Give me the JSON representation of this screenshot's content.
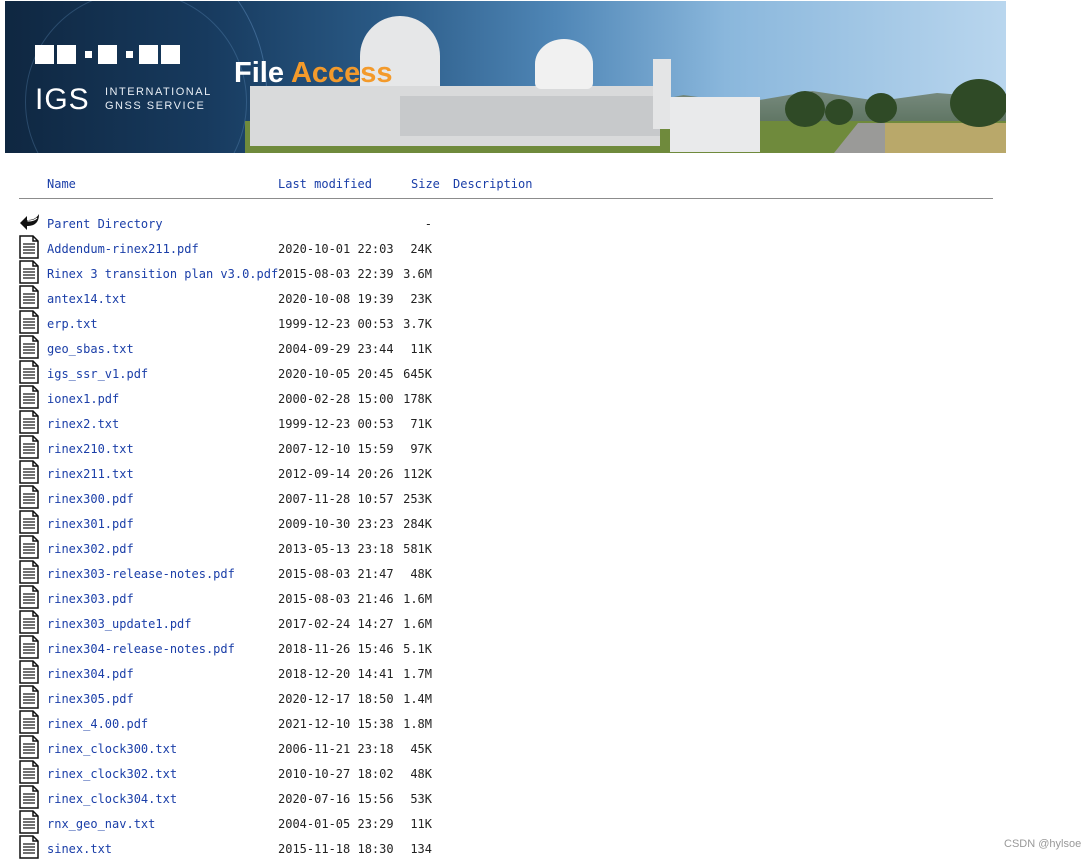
{
  "banner": {
    "org_short": "IGS",
    "org_line1": "INTERNATIONAL",
    "org_line2": "GNSS SERVICE",
    "title_white": "File",
    "title_orange": "Access",
    "colors": {
      "accent": "#f39a2b",
      "link": "#1a3ea8"
    }
  },
  "columns": {
    "name": "Name",
    "modified": "Last modified",
    "size": "Size",
    "description": "Description"
  },
  "parent": {
    "label": "Parent Directory",
    "size": "-",
    "icon": "back-arrow-icon"
  },
  "files": [
    {
      "name": "Addendum-rinex211.pdf",
      "modified": "2020-10-01 22:03",
      "size": "24K"
    },
    {
      "name": "Rinex 3 transition plan v3.0.pdf",
      "modified": "2015-08-03 22:39",
      "size": "3.6M"
    },
    {
      "name": "antex14.txt",
      "modified": "2020-10-08 19:39",
      "size": "23K"
    },
    {
      "name": "erp.txt",
      "modified": "1999-12-23 00:53",
      "size": "3.7K"
    },
    {
      "name": "geo_sbas.txt",
      "modified": "2004-09-29 23:44",
      "size": "11K"
    },
    {
      "name": "igs_ssr_v1.pdf",
      "modified": "2020-10-05 20:45",
      "size": "645K"
    },
    {
      "name": "ionex1.pdf",
      "modified": "2000-02-28 15:00",
      "size": "178K"
    },
    {
      "name": "rinex2.txt",
      "modified": "1999-12-23 00:53",
      "size": "71K"
    },
    {
      "name": "rinex210.txt",
      "modified": "2007-12-10 15:59",
      "size": "97K"
    },
    {
      "name": "rinex211.txt",
      "modified": "2012-09-14 20:26",
      "size": "112K"
    },
    {
      "name": "rinex300.pdf",
      "modified": "2007-11-28 10:57",
      "size": "253K"
    },
    {
      "name": "rinex301.pdf",
      "modified": "2009-10-30 23:23",
      "size": "284K"
    },
    {
      "name": "rinex302.pdf",
      "modified": "2013-05-13 23:18",
      "size": "581K"
    },
    {
      "name": "rinex303-release-notes.pdf",
      "modified": "2015-08-03 21:47",
      "size": "48K"
    },
    {
      "name": "rinex303.pdf",
      "modified": "2015-08-03 21:46",
      "size": "1.6M"
    },
    {
      "name": "rinex303_update1.pdf",
      "modified": "2017-02-24 14:27",
      "size": "1.6M"
    },
    {
      "name": "rinex304-release-notes.pdf",
      "modified": "2018-11-26 15:46",
      "size": "5.1K"
    },
    {
      "name": "rinex304.pdf",
      "modified": "2018-12-20 14:41",
      "size": "1.7M"
    },
    {
      "name": "rinex305.pdf",
      "modified": "2020-12-17 18:50",
      "size": "1.4M"
    },
    {
      "name": "rinex_4.00.pdf",
      "modified": "2021-12-10 15:38",
      "size": "1.8M"
    },
    {
      "name": "rinex_clock300.txt",
      "modified": "2006-11-21 23:18",
      "size": "45K"
    },
    {
      "name": "rinex_clock302.txt",
      "modified": "2010-10-27 18:02",
      "size": "48K"
    },
    {
      "name": "rinex_clock304.txt",
      "modified": "2020-07-16 15:56",
      "size": "53K"
    },
    {
      "name": "rnx_geo_nav.txt",
      "modified": "2004-01-05 23:29",
      "size": "11K"
    },
    {
      "name": "sinex.txt",
      "modified": "2015-11-18 18:30",
      "size": "134"
    }
  ],
  "file_icon": "text-document-icon",
  "watermark": "CSDN @hylsoe"
}
